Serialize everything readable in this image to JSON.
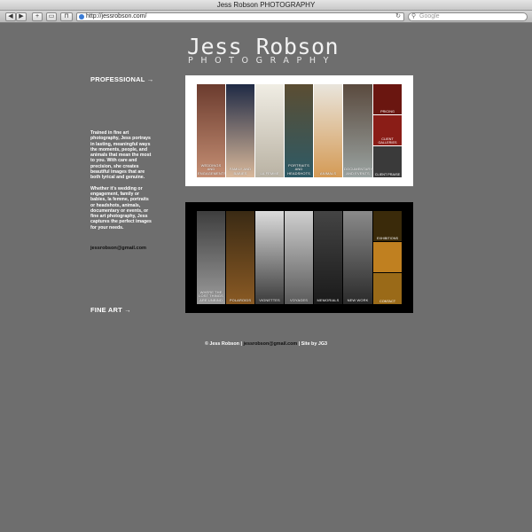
{
  "browser": {
    "window_title": "Jess Robson PHOTOGRAPHY",
    "url": "http://jessrobson.com/",
    "search_placeholder": "Google"
  },
  "logo": {
    "name": "Jess Robson",
    "tagline": "PHOTOGRAPHY"
  },
  "nav": {
    "professional": "PROFESSIONAL →",
    "fine_art": "FINE ART →"
  },
  "bio": {
    "paragraph1": "Trained in fine art photography, Jess portrays in lasting, meaningful ways the moments, people, and animals that mean the most to you. With care and precision, she creates beautiful images that are both lyrical and genuine.",
    "paragraph2": "Whether it's wedding or engagement, family or babies, la femme, portraits or headshots, animals, documentary or events, or fine art photography, Jess captures the perfect images for your needs.",
    "email": "jessrobson@gmail.com"
  },
  "professional_panel": {
    "strips": [
      {
        "label": "WEDDINGS AND ENGAGEMENTS",
        "color_top": "#6b3b2e",
        "color_bottom": "#c58f74"
      },
      {
        "label": "FAMILY AND BABIES",
        "color_top": "#1f2a45",
        "color_bottom": "#d9b89a"
      },
      {
        "label": "LA FEMME",
        "color_top": "#f0ede4",
        "color_bottom": "#b9b2a3"
      },
      {
        "label": "PORTRAITS AND HEADSHOTS",
        "color_top": "#5b4d32",
        "color_bottom": "#2d5a66"
      },
      {
        "label": "ANIMALS",
        "color_top": "#e9e5dc",
        "color_bottom": "#d49a55"
      },
      {
        "label": "DOCUMENTARY AND EVENTS",
        "color_top": "#5a4a3e",
        "color_bottom": "#9aa3a1"
      }
    ],
    "cells": [
      {
        "label": "PRICING",
        "color": "#6a1610"
      },
      {
        "label": "CLIENT GALLERIES",
        "color": "#8a1d17"
      },
      {
        "label": "CLIENT PRAISE",
        "color": "#3a3a3a"
      }
    ]
  },
  "fine_art_panel": {
    "strips": [
      {
        "label": "WHERE THE LOST THINGS ARE UNBIND",
        "color_top": "#3e3e3e",
        "color_bottom": "#9b9b9b"
      },
      {
        "label": "POLAROIDS",
        "color_top": "#3a2a14",
        "color_bottom": "#8a5a24"
      },
      {
        "label": "VIGNETTES",
        "color_top": "#dcdcdc",
        "color_bottom": "#3a3a3a"
      },
      {
        "label": "VOYAGES",
        "color_top": "#cfcfcf",
        "color_bottom": "#5a5a5a"
      },
      {
        "label": "MEMORIALS",
        "color_top": "#444444",
        "color_bottom": "#1a1a1a"
      },
      {
        "label": "NEW WORK",
        "color_top": "#8a8a8a",
        "color_bottom": "#2a2a2a"
      }
    ],
    "cells": [
      {
        "label": "EXHIBITIONS",
        "color": "#3a2a0a"
      },
      {
        "label": "",
        "color": "#c08020"
      },
      {
        "label": "CONTACT",
        "color": "#9a6a18"
      }
    ]
  },
  "footer": {
    "copyright": "© Jess Robson |",
    "email": "jessrobson@gmail.com",
    "credit": "| Site by JG3"
  }
}
